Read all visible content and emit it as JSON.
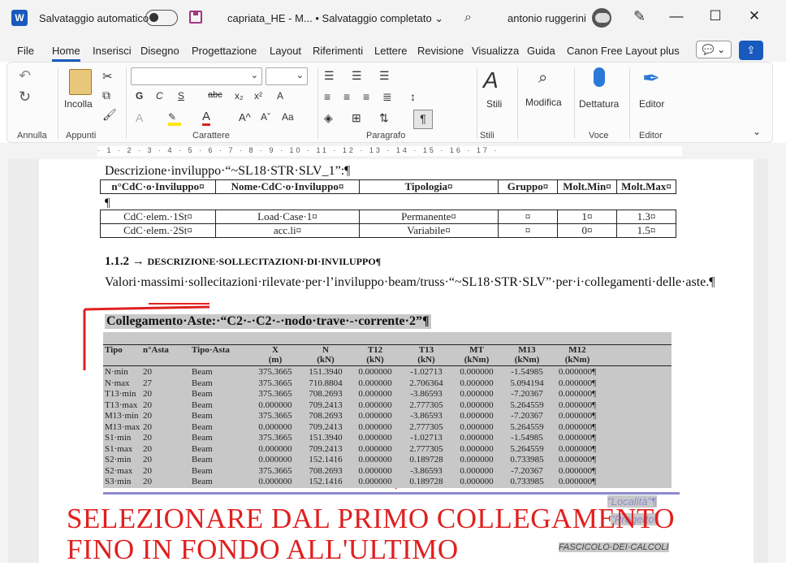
{
  "titlebar": {
    "app_icon": "W",
    "autosave_label": "Salvataggio automatico",
    "doc_title": "capriata_HE  -  M...  • Salvataggio completato  ⌄",
    "user_name": "antonio ruggerini",
    "minimize": "—",
    "maximize": "☐",
    "close": "✕"
  },
  "menu": {
    "items": [
      "File",
      "Home",
      "Inserisci",
      "Disegno",
      "Progettazione",
      "Layout",
      "Riferimenti",
      "Lettere",
      "Revisione",
      "Visualizza",
      "Guida",
      "Canon Free Layout plus"
    ],
    "active": "Home"
  },
  "ribbon": {
    "groups": {
      "annulla": "Annulla",
      "appunti": "Appunti",
      "carattere": "Carattere",
      "paragrafo": "Paragrafo",
      "stili": "Stili",
      "voce": "Voce",
      "editor": "Editor"
    },
    "incolla": "Incolla",
    "stili_btn": "Stili",
    "modifica_btn": "Modifica",
    "dettatura_btn": "Dettatura",
    "editor_btn": "Editor",
    "font_buttons": [
      "G",
      "C",
      "S",
      "abc",
      "x₂",
      "x²",
      "A"
    ]
  },
  "ruler": {
    "ticks": "· 1 · 2 · 3 · 4 · 5 · 6 · 7 · 8 · 9 · 10 · 11 · 12 · 13 · 14 · 15 · 16 · 17 ·"
  },
  "document": {
    "desc_title": "Descrizione·inviluppo·“~SL18·STR·SLV_1”:¶",
    "table1": {
      "headers": [
        "n°CdC·o·Inviluppo¤",
        "Nome·CdC·o·Inviluppo¤",
        "Tipologia¤",
        "Gruppo¤",
        "Molt.Min¤",
        "Molt.Max¤"
      ]
    },
    "pilcrow": "¶",
    "table2": {
      "rows": [
        [
          "CdC·elem.·1St¤",
          "Load·Case·1¤",
          "Permanente¤",
          "¤",
          "1¤",
          "1.3¤"
        ],
        [
          "CdC·elem.·2St¤",
          "acc.li¤",
          "Variabile¤",
          "¤",
          "0¤",
          "1.5¤"
        ]
      ]
    },
    "section_num": "1.1.2 → ",
    "section_title": "DESCRIZIONE·SOLLECITAZIONI·DI·INVILUPPO¶",
    "body_text": "Valori·massimi·sollecitazioni·rilevate·per·l’inviluppo·beam/truss·“~SL18·STR·SLV”·per·i·collegamenti·delle·aste.¶",
    "collegamento": "Collegamento·Aste:·“C2·-·C2·-·nodo·trave·-·corrente·2”¶",
    "col_headers_1": [
      "Tipo",
      "n°Asta",
      "Tipo·Asta",
      "X",
      "N",
      "T12",
      "T13",
      "MT",
      "M13",
      "M12"
    ],
    "col_headers_2": [
      "",
      "",
      "",
      "(m)",
      "(kN)",
      "(kN)",
      "(kN)",
      "(kNm)",
      "(kNm)",
      "(kNm)"
    ],
    "rows": [
      [
        "N·min",
        "20",
        "Beam",
        "375.3665",
        "151.3940",
        "0.000000",
        "-1.02713",
        "0.000000",
        "-1.54985",
        "0.000000¶"
      ],
      [
        "N·max",
        "27",
        "Beam",
        "375.3665",
        "710.8804",
        "0.000000",
        "2.706364",
        "0.000000",
        "5.094194",
        "0.000000¶"
      ],
      [
        "T13·min",
        "20",
        "Beam",
        "375.3665",
        "708.2693",
        "0.000000",
        "-3.86593",
        "0.000000",
        "-7.20367",
        "0.000000¶"
      ],
      [
        "T13·max",
        "20",
        "Beam",
        "0.000000",
        "709.2413",
        "0.000000",
        "2.777305",
        "0.000000",
        "5.264559",
        "0.000000¶"
      ],
      [
        "M13·min",
        "20",
        "Beam",
        "375.3665",
        "708.2693",
        "0.000000",
        "-3.86593",
        "0.000000",
        "-7.20367",
        "0.000000¶"
      ],
      [
        "M13·max",
        "20",
        "Beam",
        "0.000000",
        "709.2413",
        "0.000000",
        "2.777305",
        "0.000000",
        "5.264559",
        "0.000000¶"
      ],
      [
        "S1·min",
        "20",
        "Beam",
        "375.3665",
        "151.3940",
        "0.000000",
        "-1.02713",
        "0.000000",
        "-1.54985",
        "0.000000¶"
      ],
      [
        "S1·max",
        "20",
        "Beam",
        "0.000000",
        "709.2413",
        "0.000000",
        "2.777305",
        "0.000000",
        "5.264559",
        "0.000000¶"
      ],
      [
        "S2·min",
        "20",
        "Beam",
        "0.000000",
        "152.1416",
        "0.000000",
        "0.189728",
        "0.000000",
        "0.733985",
        "0.000000¶"
      ],
      [
        "S2·max",
        "20",
        "Beam",
        "375.3665",
        "708.2693",
        "0.000000",
        "-3.86593",
        "0.000000",
        "-7.20367",
        "0.000000¶"
      ],
      [
        "S3·min",
        "20",
        "Beam",
        "0.000000",
        "152.1416",
        "0.000000",
        "0.189728",
        "0.000000",
        "0.733985",
        "0.000000¶"
      ]
    ],
    "localita": "\"Località\"¶",
    "progetto": "\"Progetto\"",
    "fascicolo": "FASCICOLO·DEI·CALCOLI"
  },
  "annotation": {
    "line1": "SELEZIONARE DAL PRIMO COLLEGAMENTO",
    "line2": "FINO IN FONDO ALL'ULTIMO",
    "color": "#e02020"
  }
}
